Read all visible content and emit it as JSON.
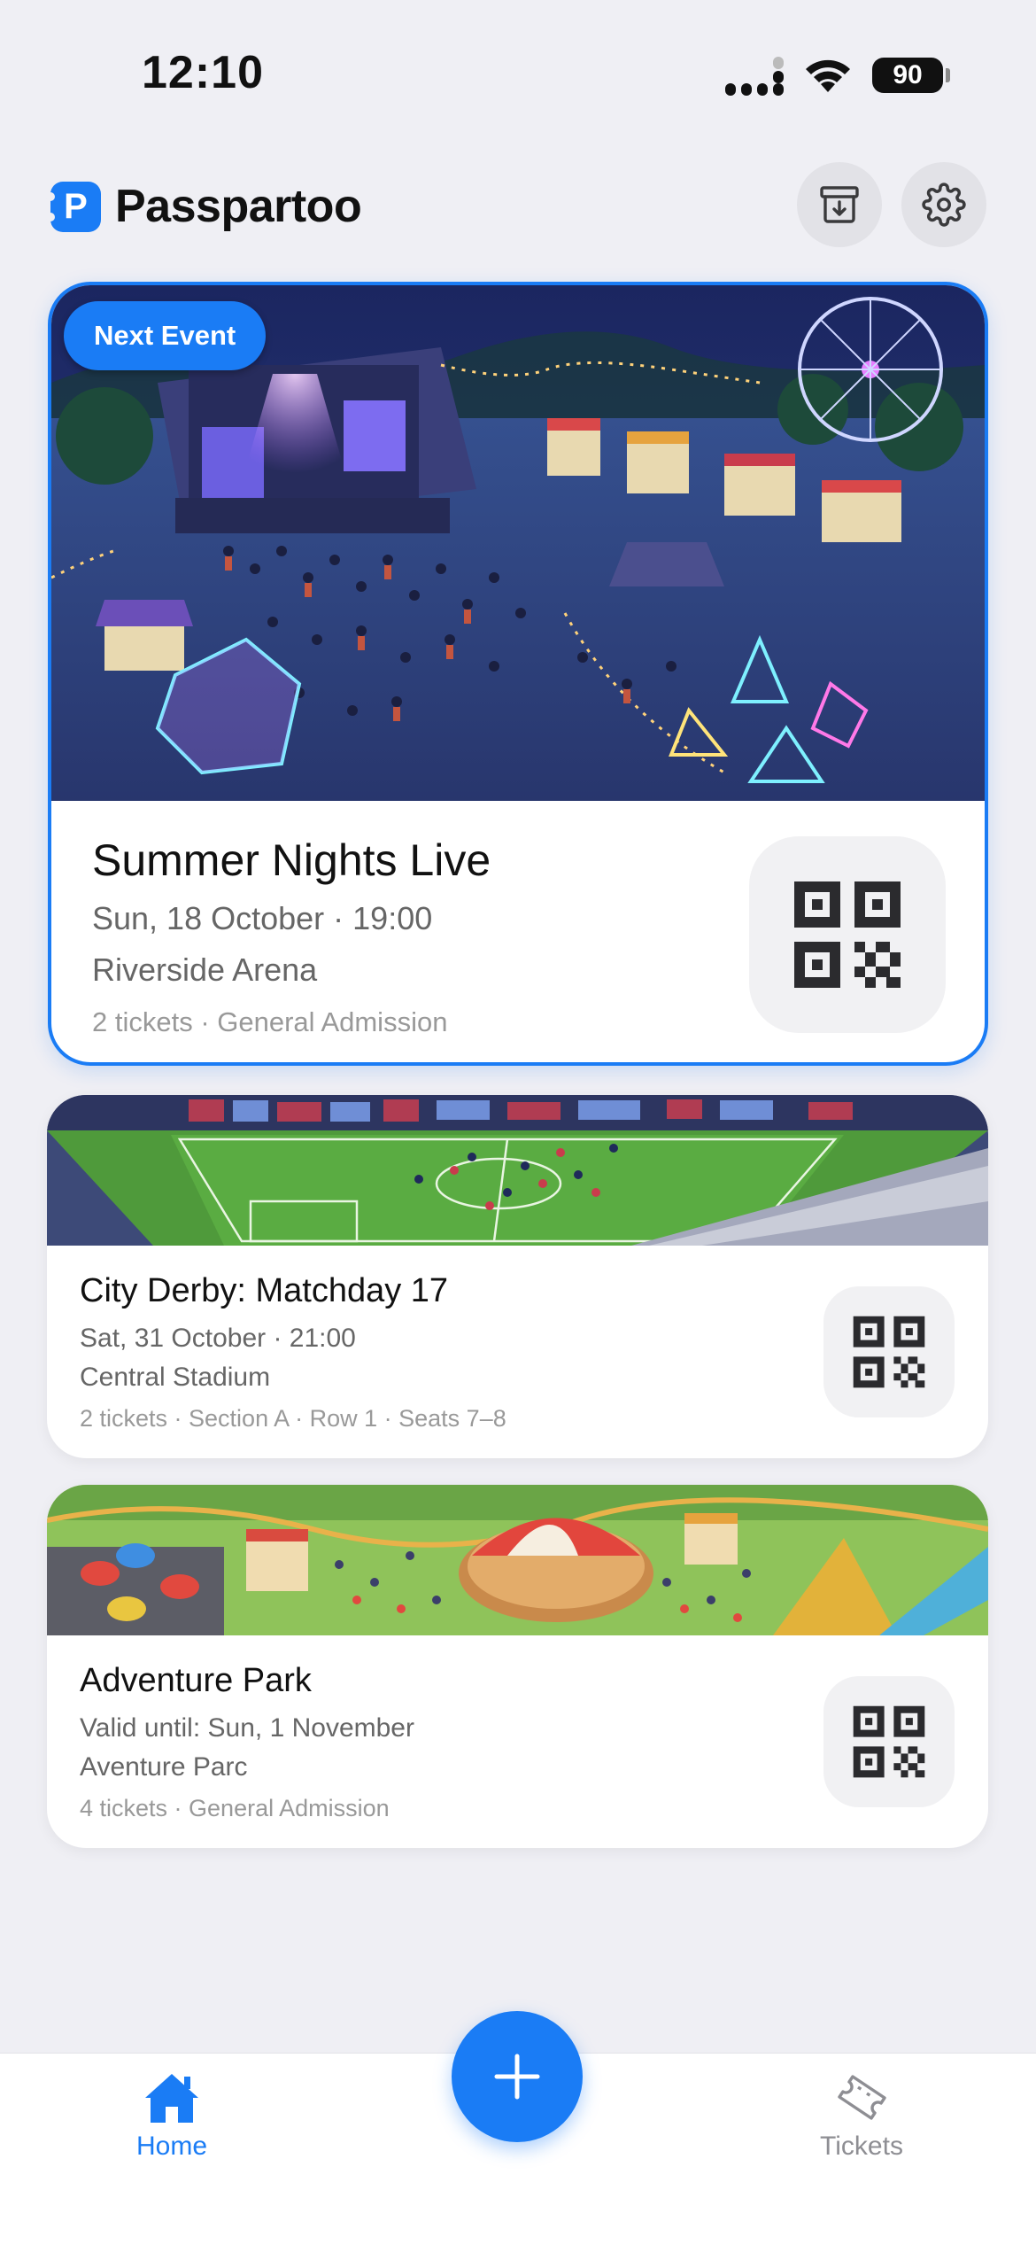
{
  "status_bar": {
    "time": "12:10",
    "battery": "90",
    "icons": [
      "signal-icon",
      "wifi-icon",
      "battery-icon"
    ]
  },
  "header": {
    "logo_letter": "P",
    "app_name": "Passpartoo",
    "buttons": [
      {
        "name": "archive",
        "icon": "archive-download-icon"
      },
      {
        "name": "settings",
        "icon": "gear-icon"
      }
    ]
  },
  "events": [
    {
      "badge": "Next Event",
      "title": "Summer Nights Live",
      "date": "Sun, 18 October · 19:00",
      "venue": "Riverside Arena",
      "meta": "2 tickets · General Admission",
      "image": "concert-festival-illustration",
      "icon": "qr-code-icon"
    },
    {
      "title": "City Derby: Matchday 17",
      "date": "Sat, 31 October · 21:00",
      "venue": "Central Stadium",
      "meta": "2 tickets · Section A · Row 1 · Seats 7–8",
      "image": "football-stadium-illustration",
      "icon": "qr-code-icon"
    },
    {
      "title": "Adventure Park",
      "date": "Valid until: Sun, 1 November",
      "venue": "Aventure Parc",
      "meta": "4 tickets · General Admission",
      "image": "amusement-park-illustration",
      "icon": "qr-code-icon"
    }
  ],
  "tab_bar": {
    "tabs": [
      {
        "label": "Home",
        "icon": "home-icon",
        "active": true
      },
      {
        "label": "Tickets",
        "icon": "ticket-icon",
        "active": false
      }
    ],
    "fab_icon": "plus-icon"
  },
  "colors": {
    "accent": "#1a7cf5",
    "background": "#efeff4",
    "card": "#ffffff",
    "text_primary": "#111111",
    "text_secondary": "#666666",
    "text_tertiary": "#999999",
    "tab_inactive": "#8e8e93"
  }
}
